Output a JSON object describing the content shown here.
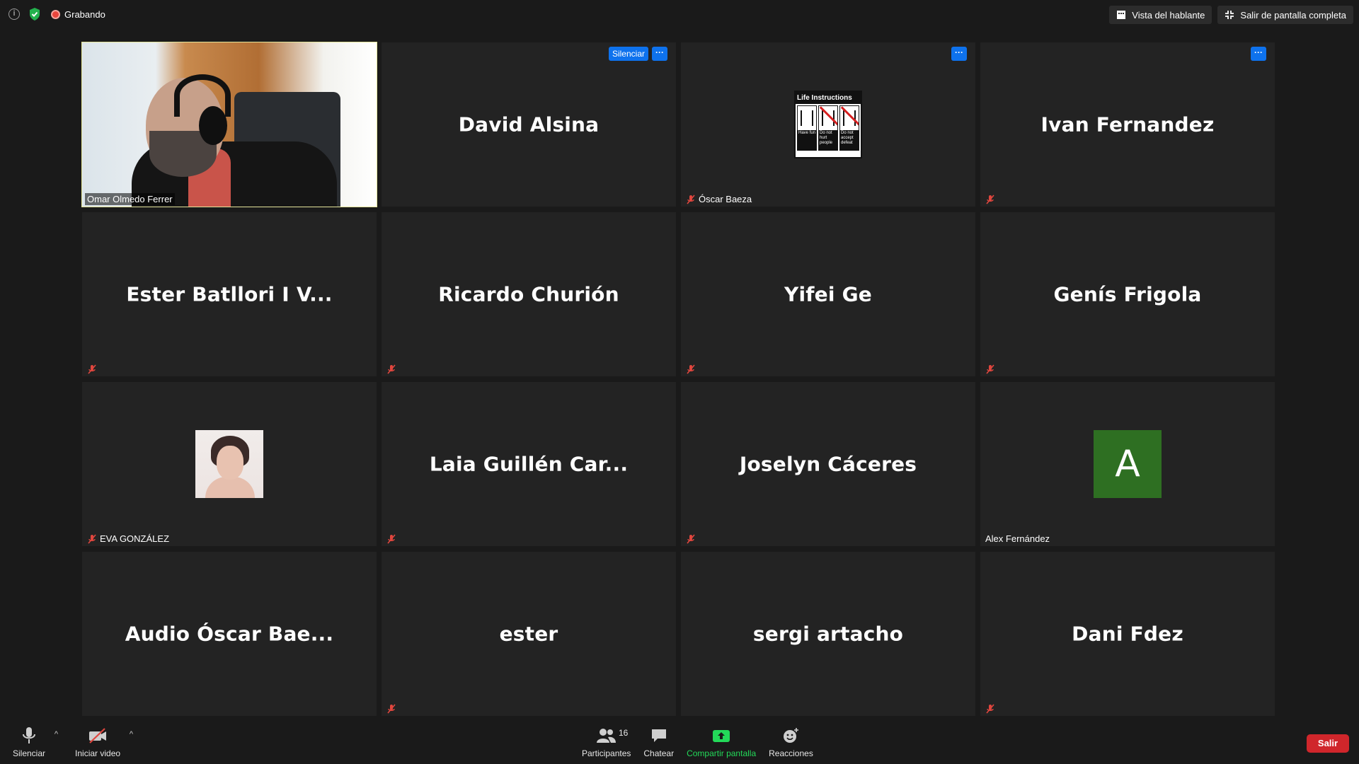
{
  "topbar": {
    "recording_label": "Grabando",
    "speaker_view_label": "Vista del hablante",
    "exit_fullscreen_label": "Salir de pantalla completa"
  },
  "tiles": {
    "t1": {
      "label": "Omar Olmedo Ferrer"
    },
    "t2": {
      "name": "David Alsina",
      "mute_label": "Silenciar",
      "more_label": "···"
    },
    "t3": {
      "label": "Óscar Baeza",
      "more_label": "···",
      "image_title": "Life Instructions",
      "captions": [
        "Have fun",
        "Do not hurt people",
        "Do not accept defeat"
      ]
    },
    "t4": {
      "name": "Ivan Fernandez",
      "more_label": "···"
    },
    "t5": {
      "name": "Ester Batllori I V..."
    },
    "t6": {
      "name": "Ricardo Churión"
    },
    "t7": {
      "name": "Yifei Ge"
    },
    "t8": {
      "name": "Genís Frigola"
    },
    "t9": {
      "label": "EVA GONZÁLEZ"
    },
    "t10": {
      "name": "Laia Guillén Car..."
    },
    "t11": {
      "name": "Joselyn Cáceres"
    },
    "t12": {
      "label": "Alex Fernández",
      "avatar_letter": "A"
    },
    "t13": {
      "name": "Audio Óscar Bae..."
    },
    "t14": {
      "name": "ester"
    },
    "t15": {
      "name": "sergi artacho"
    },
    "t16": {
      "name": "Dani Fdez"
    }
  },
  "toolbar": {
    "mute_label": "Silenciar",
    "video_label": "Iniciar video",
    "participants_label": "Participantes",
    "participants_count": "16",
    "chat_label": "Chatear",
    "share_label": "Compartir pantalla",
    "reactions_label": "Reacciones",
    "leave_label": "Salir"
  },
  "colors": {
    "active_speaker_outline": "#e5e59a",
    "accent_blue": "#0e72ed",
    "share_green": "#23d959",
    "leave_red": "#d0262b",
    "avatar_green": "#2e6f22"
  }
}
